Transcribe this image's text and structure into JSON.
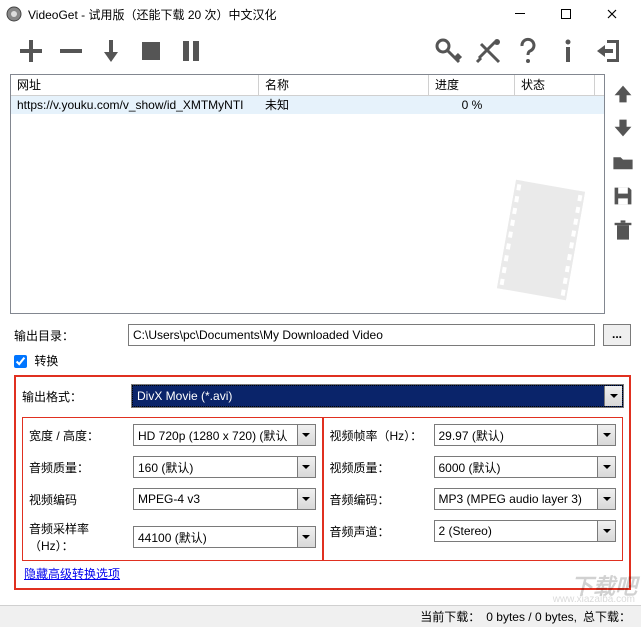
{
  "window": {
    "title": "VideoGet - 试用版（还能下载 20 次）中文汉化"
  },
  "table": {
    "headers": {
      "url": "网址",
      "name": "名称",
      "progress": "进度",
      "state": "状态"
    },
    "rows": [
      {
        "url": "https://v.youku.com/v_show/id_XMTMyNTI",
        "name": "未知",
        "progress": "0 %",
        "state": ""
      }
    ]
  },
  "output": {
    "label": "输出目录：",
    "path": "C:\\Users\\pc\\Documents\\My Downloaded Video",
    "browse": "..."
  },
  "convert": {
    "label": "转换"
  },
  "settings": {
    "format_label": "输出格式：",
    "format_value": "DivX Movie (*.avi)",
    "left": {
      "wh_label": "宽度 / 高度：",
      "wh_value": "HD 720p (1280 x 720) (默认",
      "aq_label": "音频质量：",
      "aq_value": "160 (默认)",
      "vc_label": "视频编码",
      "vc_value": "MPEG-4 v3",
      "asr_label": "音频采样率（Hz）：",
      "asr_value": "44100 (默认)"
    },
    "right": {
      "fps_label": "视频帧率（Hz）：",
      "fps_value": "29.97 (默认)",
      "vq_label": "视频质量：",
      "vq_value": "6000 (默认)",
      "ac_label": "音频编码：",
      "ac_value": "MP3 (MPEG audio layer 3)",
      "ch_label": "音频声道：",
      "ch_value": "2 (Stereo)"
    },
    "hide_link": "隐藏高级转换选项"
  },
  "status": {
    "current": "当前下载：",
    "bytes": "0 bytes / 0 bytes,",
    "total": "总下载："
  },
  "watermark": {
    "main": "下载吧",
    "sub": "www.xiazaiba.com"
  }
}
